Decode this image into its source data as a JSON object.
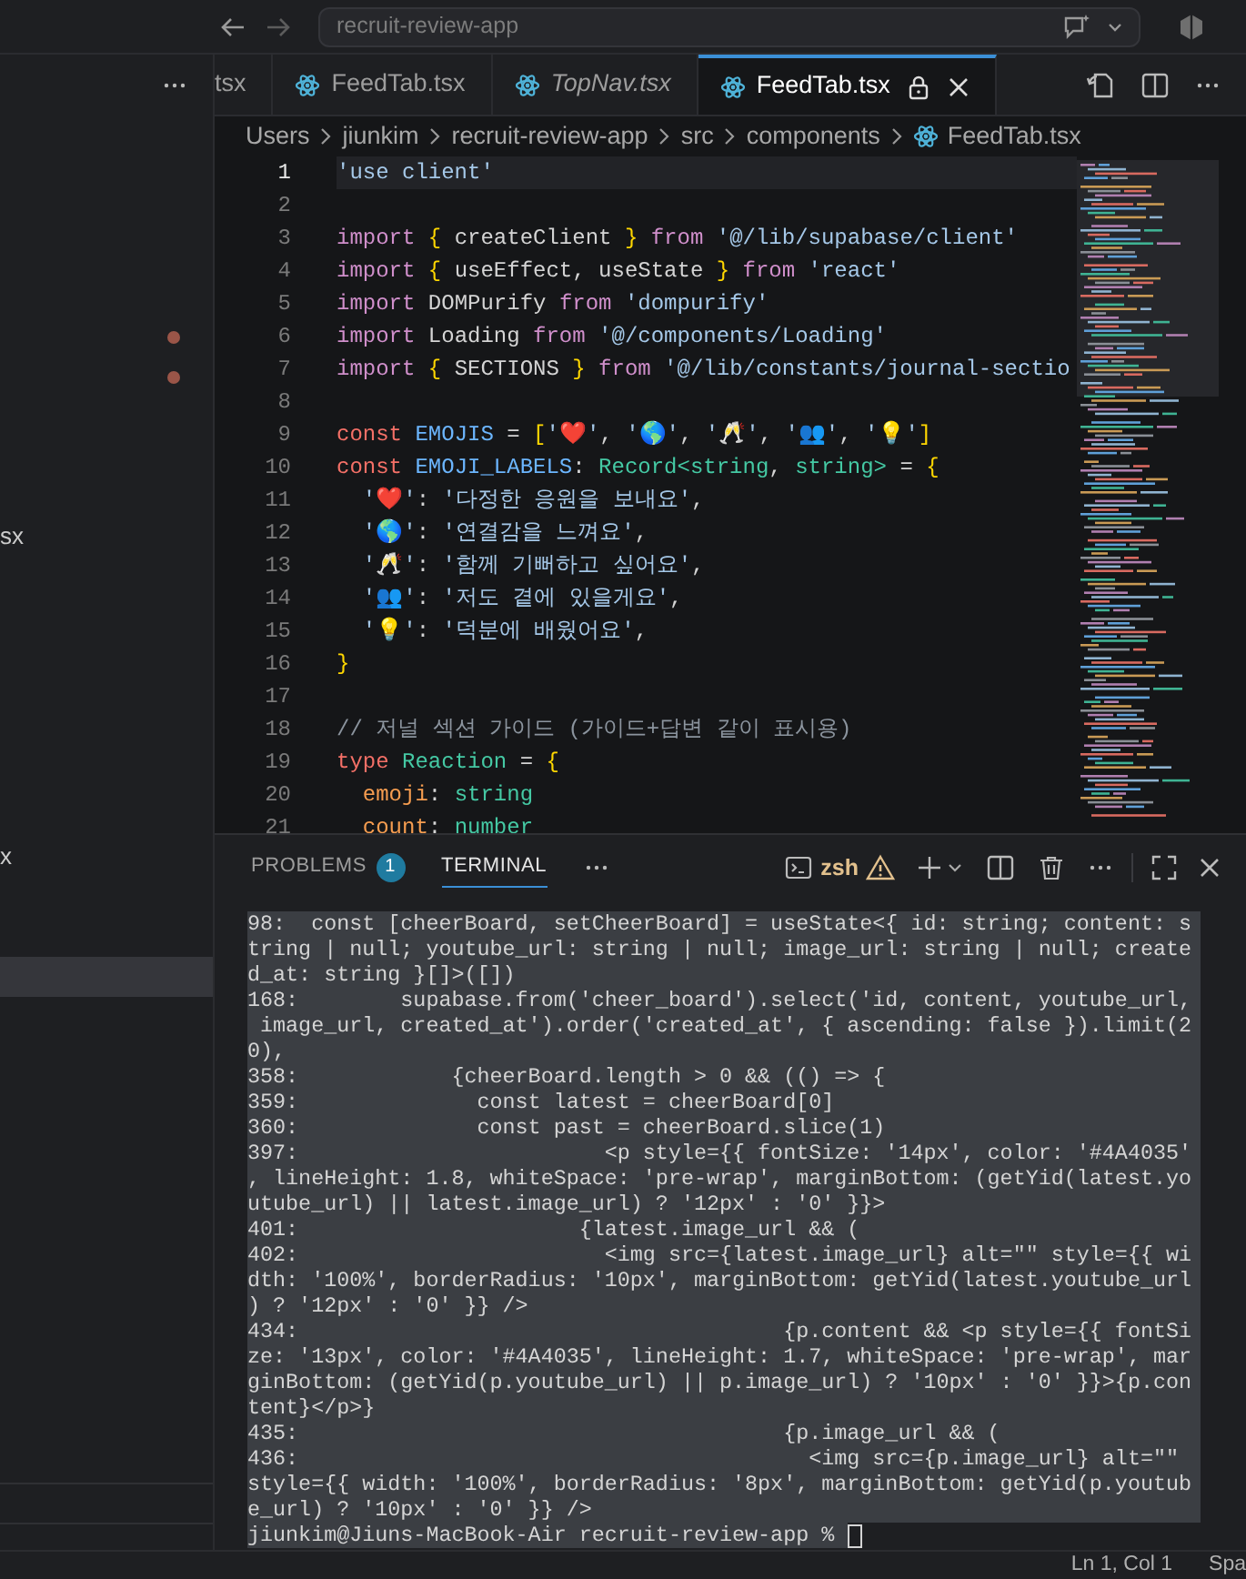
{
  "title_bar": {
    "search_text": "recruit-review-app"
  },
  "sidebar": {
    "rows": [
      {
        "selected": false,
        "modified": false
      },
      {
        "selected": false,
        "modified": false
      },
      {
        "selected": false,
        "modified": false
      },
      {
        "selected": false,
        "modified": false
      },
      {
        "selected": false,
        "modified": false
      },
      {
        "selected": false,
        "modified": true
      },
      {
        "selected": false,
        "modified": true
      },
      {
        "selected": false,
        "modified": false
      },
      {
        "selected": false,
        "modified": false
      },
      {
        "selected": false,
        "modified": false
      },
      {
        "selected": false,
        "modified": false,
        "label": "sx"
      },
      {
        "selected": false,
        "modified": false
      },
      {
        "selected": false,
        "modified": false
      },
      {
        "selected": false,
        "modified": false
      },
      {
        "selected": false,
        "modified": false
      },
      {
        "selected": false,
        "modified": false
      },
      {
        "selected": false,
        "modified": false
      },
      {
        "selected": false,
        "modified": false
      },
      {
        "selected": false,
        "modified": false,
        "label": "x"
      },
      {
        "selected": false,
        "modified": false
      },
      {
        "selected": false,
        "modified": false
      },
      {
        "selected": true,
        "modified": false
      }
    ]
  },
  "tabs": [
    {
      "label": "tsx",
      "clipped": true,
      "preview": false,
      "selected": false
    },
    {
      "label": "FeedTab.tsx",
      "clipped": false,
      "preview": false,
      "selected": false
    },
    {
      "label": "TopNav.tsx",
      "clipped": false,
      "preview": true,
      "selected": false
    },
    {
      "label": "FeedTab.tsx",
      "clipped": false,
      "preview": false,
      "selected": true
    }
  ],
  "breadcrumb": [
    "Users",
    "jiunkim",
    "recruit-review-app",
    "src",
    "components",
    "FeedTab.tsx"
  ],
  "code_lines": [
    {
      "number": "1",
      "current": true,
      "tokens": [
        {
          "kind": "str",
          "text": "'use client'"
        }
      ]
    },
    {
      "number": "2",
      "current": false
    },
    {
      "number": "3",
      "current": false,
      "tokens": [
        {
          "kind": "kw",
          "text": "import"
        },
        {
          "kind": "brace",
          "text": " {"
        },
        {
          "kind": "plain",
          "text": " createClient "
        },
        {
          "kind": "brace",
          "text": "}"
        },
        {
          "kind": "kw",
          "text": " from"
        },
        {
          "kind": "str",
          "text": " '@/lib/supabase/client'"
        }
      ]
    },
    {
      "number": "4",
      "current": false,
      "tokens": [
        {
          "kind": "kw",
          "text": "import"
        },
        {
          "kind": "brace",
          "text": " {"
        },
        {
          "kind": "plain",
          "text": " useEffect, useState "
        },
        {
          "kind": "brace",
          "text": "}"
        },
        {
          "kind": "kw",
          "text": " from"
        },
        {
          "kind": "str",
          "text": " 'react'"
        }
      ]
    },
    {
      "number": "5",
      "current": false,
      "tokens": [
        {
          "kind": "kw",
          "text": "import"
        },
        {
          "kind": "plain",
          "text": " DOMPurify "
        },
        {
          "kind": "kw",
          "text": "from"
        },
        {
          "kind": "str",
          "text": " 'dompurify'"
        }
      ]
    },
    {
      "number": "6",
      "current": false,
      "tokens": [
        {
          "kind": "kw",
          "text": "import"
        },
        {
          "kind": "plain",
          "text": " Loading "
        },
        {
          "kind": "kw",
          "text": "from"
        },
        {
          "kind": "str",
          "text": " '@/components/Loading'"
        }
      ]
    },
    {
      "number": "7",
      "current": false,
      "tokens": [
        {
          "kind": "kw",
          "text": "import"
        },
        {
          "kind": "brace",
          "text": " {"
        },
        {
          "kind": "plain",
          "text": " SECTIONS "
        },
        {
          "kind": "brace",
          "text": "}"
        },
        {
          "kind": "kw",
          "text": " from"
        },
        {
          "kind": "str",
          "text": " '@/lib/constants/journal-sectio"
        }
      ]
    },
    {
      "number": "8",
      "current": false
    },
    {
      "number": "9",
      "current": false,
      "tokens": [
        {
          "kind": "decl",
          "text": "const"
        },
        {
          "kind": "var",
          "text": " EMOJIS"
        },
        {
          "kind": "plain",
          "text": " = "
        },
        {
          "kind": "brace",
          "text": "["
        },
        {
          "kind": "str",
          "text": "'❤️'"
        },
        {
          "kind": "plain",
          "text": ", "
        },
        {
          "kind": "str",
          "text": "'🌎'"
        },
        {
          "kind": "plain",
          "text": ", "
        },
        {
          "kind": "str",
          "text": "'🥂'"
        },
        {
          "kind": "plain",
          "text": ", "
        },
        {
          "kind": "str",
          "text": "'👥'"
        },
        {
          "kind": "plain",
          "text": ", "
        },
        {
          "kind": "str",
          "text": "'💡'"
        },
        {
          "kind": "brace",
          "text": "]"
        }
      ]
    },
    {
      "number": "10",
      "current": false,
      "tokens": [
        {
          "kind": "decl",
          "text": "const"
        },
        {
          "kind": "var",
          "text": " EMOJI_LABELS"
        },
        {
          "kind": "plain",
          "text": ": "
        },
        {
          "kind": "type",
          "text": "Record<string"
        },
        {
          "kind": "plain",
          "text": ", "
        },
        {
          "kind": "type",
          "text": "string>"
        },
        {
          "kind": "plain",
          "text": " = "
        },
        {
          "kind": "brace",
          "text": "{"
        }
      ]
    },
    {
      "number": "11",
      "current": false,
      "tokens": [
        {
          "kind": "str",
          "text": "  '❤️'"
        },
        {
          "kind": "plain",
          "text": ": "
        },
        {
          "kind": "str",
          "text": "'다정한 응원을 보내요'"
        },
        {
          "kind": "plain",
          "text": ","
        }
      ]
    },
    {
      "number": "12",
      "current": false,
      "tokens": [
        {
          "kind": "str",
          "text": "  '🌎'"
        },
        {
          "kind": "plain",
          "text": ": "
        },
        {
          "kind": "str",
          "text": "'연결감을 느껴요'"
        },
        {
          "kind": "plain",
          "text": ","
        }
      ]
    },
    {
      "number": "13",
      "current": false,
      "tokens": [
        {
          "kind": "str",
          "text": "  '🥂'"
        },
        {
          "kind": "plain",
          "text": ": "
        },
        {
          "kind": "str",
          "text": "'함께 기뻐하고 싶어요'"
        },
        {
          "kind": "plain",
          "text": ","
        }
      ]
    },
    {
      "number": "14",
      "current": false,
      "tokens": [
        {
          "kind": "str",
          "text": "  '👥'"
        },
        {
          "kind": "plain",
          "text": ": "
        },
        {
          "kind": "str",
          "text": "'저도 곁에 있을게요'"
        },
        {
          "kind": "plain",
          "text": ","
        }
      ]
    },
    {
      "number": "15",
      "current": false,
      "tokens": [
        {
          "kind": "str",
          "text": "  '💡'"
        },
        {
          "kind": "plain",
          "text": ": "
        },
        {
          "kind": "str",
          "text": "'덕분에 배웠어요'"
        },
        {
          "kind": "plain",
          "text": ","
        }
      ]
    },
    {
      "number": "16",
      "current": false,
      "tokens": [
        {
          "kind": "brace",
          "text": "}"
        }
      ]
    },
    {
      "number": "17",
      "current": false
    },
    {
      "number": "18",
      "current": false,
      "tokens": [
        {
          "kind": "comment",
          "text": "// 저널 섹션 가이드 (가이드+답변 같이 표시용)"
        }
      ]
    },
    {
      "number": "19",
      "current": false,
      "tokens": [
        {
          "kind": "decl",
          "text": "type"
        },
        {
          "kind": "type",
          "text": " Reaction"
        },
        {
          "kind": "plain",
          "text": " = "
        },
        {
          "kind": "brace",
          "text": "{"
        }
      ]
    },
    {
      "number": "20",
      "current": false,
      "tokens": [
        {
          "kind": "prop",
          "text": "  emoji"
        },
        {
          "kind": "plain",
          "text": ": "
        },
        {
          "kind": "type",
          "text": "string"
        }
      ]
    },
    {
      "number": "21",
      "current": false,
      "tokens": [
        {
          "kind": "prop",
          "text": "  count"
        },
        {
          "kind": "plain",
          "text": ": "
        },
        {
          "kind": "type",
          "text": "number"
        }
      ]
    }
  ],
  "panel": {
    "tabs": [
      {
        "label": "PROBLEMS",
        "badge": "1",
        "selected": false
      },
      {
        "label": "TERMINAL",
        "selected": true
      }
    ],
    "shell": "zsh",
    "terminal_lines": [
      "98:  const [cheerBoard, setCheerBoard] = useState<{ id: string; content: s",
      "tring | null; youtube_url: string | null; image_url: string | null; create",
      "d_at: string }[]>([])",
      "168:        supabase.from('cheer_board').select('id, content, youtube_url,",
      " image_url, created_at').order('created_at', { ascending: false }).limit(2",
      "0),",
      "358:            {cheerBoard.length > 0 && (() => {",
      "359:              const latest = cheerBoard[0]",
      "360:              const past = cheerBoard.slice(1)",
      "397:                        <p style={{ fontSize: '14px', color: '#4A4035'",
      ", lineHeight: 1.8, whiteSpace: 'pre-wrap', marginBottom: (getYid(latest.yo",
      "utube_url) || latest.image_url) ? '12px' : '0' }}>",
      "401:                      {latest.image_url && (",
      "402:                        <img src={latest.image_url} alt=\"\" style={{ wi",
      "dth: '100%', borderRadius: '10px', marginBottom: getYid(latest.youtube_url",
      ") ? '12px' : '0' }} />",
      "434:                                      {p.content && <p style={{ fontSi",
      "ze: '13px', color: '#4A4035', lineHeight: 1.7, whiteSpace: 'pre-wrap', mar",
      "ginBottom: (getYid(p.youtube_url) || p.image_url) ? '10px' : '0' }}>{p.con",
      "tent}</p>}",
      "435:                                      {p.image_url && (",
      "436:                                        <img src={p.image_url} alt=\"\"",
      "style={{ width: '100%', borderRadius: '8px', marginBottom: getYid(p.youtub",
      "e_url) ? '10px' : '0' }} />"
    ],
    "prompt": "jiunkim@Jiuns-MacBook-Air recruit-review-app % "
  },
  "status_bar": [
    "Ln 1, Col 1",
    "Spa"
  ]
}
